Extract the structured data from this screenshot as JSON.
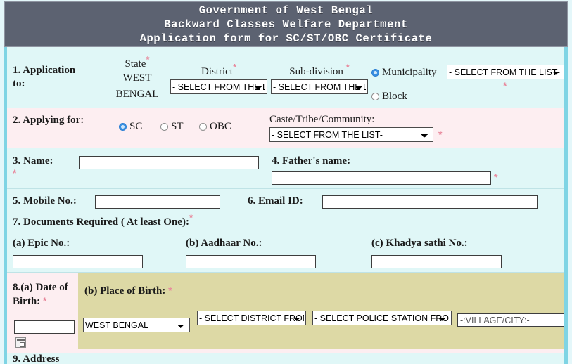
{
  "header": {
    "line1": "Government of West Bengal",
    "line2": "Backward Classes Welfare Department",
    "line3": "Application form for SC/ST/OBC Certificate",
    "bg_color": "#5c6271",
    "text_color": "#ffffff"
  },
  "colors": {
    "page_bg": "#e4f7fa",
    "row_cyan": "#e0f7f7",
    "row_pink": "#fdeef1",
    "khaki": "#ddd9a5",
    "border_teal": "#7fd4e4",
    "required_star": "#e8889c",
    "radio_selected": "#3a8fe0"
  },
  "row1": {
    "label": "1. Application to:",
    "state_label": "State",
    "state_value": "WEST BENGAL",
    "district_label": "District",
    "district_select": "- SELECT FROM THE LIST-",
    "subdivision_label": "Sub-division",
    "subdivision_select": "- SELECT FROM THE LIST-",
    "municipality_label": "Municipality",
    "block_label": "Block",
    "area_type_selected": "Municipality",
    "municipality_select": "- SELECT FROM THE LIST-",
    "required_marker": "*"
  },
  "row2": {
    "label": "2. Applying for:",
    "options": [
      {
        "label": "SC",
        "selected": true
      },
      {
        "label": "ST",
        "selected": false
      },
      {
        "label": "OBC",
        "selected": false
      }
    ],
    "caste_label": "Caste/Tribe/Community:",
    "caste_select": "- SELECT FROM THE LIST-",
    "required_marker": "*"
  },
  "row3": {
    "name_label": "3. Name:",
    "name_value": "",
    "father_label": "4. Father's name:",
    "father_value": "",
    "required_marker": "*"
  },
  "row4": {
    "mobile_label": "5. Mobile No.:",
    "mobile_value": "",
    "email_label": "6. Email ID:",
    "email_value": ""
  },
  "row5": {
    "label": "7. Documents Required ( At least One):",
    "required_marker": "*"
  },
  "row6": {
    "epic_label": "(a) Epic No.:",
    "epic_value": "",
    "aadhaar_label": "(b) Aadhaar No.:",
    "aadhaar_value": "",
    "khadya_label": "(c) Khadya sathi No.:",
    "khadya_value": ""
  },
  "row7": {
    "dob_label": "8.(a) Date of Birth:",
    "dob_value": "",
    "pob_label": "(b) Place of Birth:",
    "pob_state_select": "WEST BENGAL",
    "pob_district_select": "- SELECT DISTRICT FROM THE LIST-",
    "pob_police_select": "- SELECT POLICE STATION FROM THE LIST-",
    "pob_village_placeholder": "-:VILLAGE/CITY:-",
    "pob_village_value": "",
    "required_marker": "*",
    "calendar_icon": "calendar-icon"
  },
  "row8": {
    "label": "9. Address"
  }
}
